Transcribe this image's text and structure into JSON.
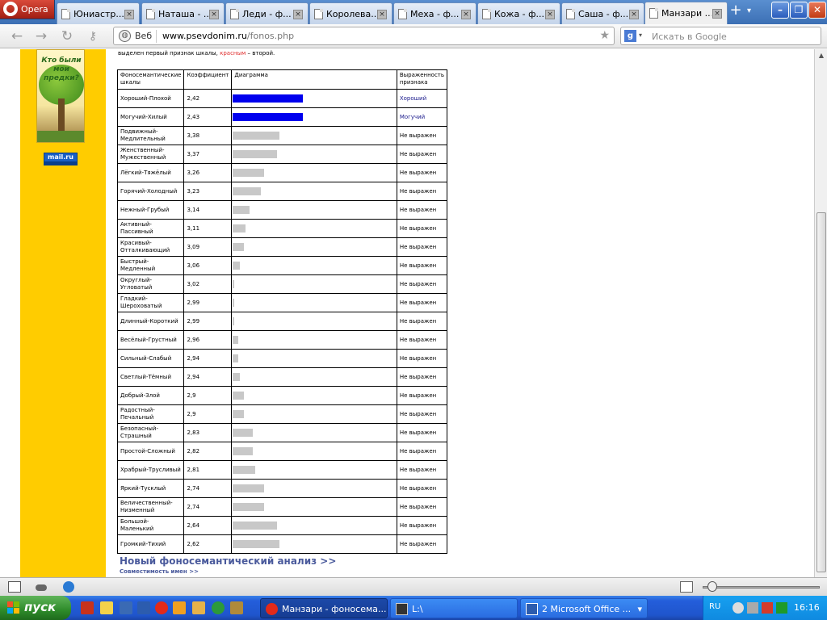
{
  "browser": {
    "menu_label": "Opera",
    "tabs": [
      {
        "title": "Юниастр..."
      },
      {
        "title": "Наташа - ..."
      },
      {
        "title": "Леди - ф..."
      },
      {
        "title": "Королева..."
      },
      {
        "title": "Меха - ф..."
      },
      {
        "title": "Кожа - ф..."
      },
      {
        "title": "Саша - ф..."
      },
      {
        "title": "Манзари ..."
      }
    ],
    "new_tab_symbol": "+",
    "address": {
      "site_label": "Веб",
      "host": "www.psevdonim.ru",
      "path": "/fonos.php"
    },
    "search": {
      "engine_badge": "g",
      "placeholder": "Искать в Google"
    }
  },
  "page": {
    "sidebar": {
      "banner_text": "Кто были мои предки?",
      "counter_text": "mail.ru"
    },
    "intro": {
      "before": "выделен первый признак шкалы, ",
      "red_word": "красным",
      "after": " – второй."
    },
    "table": {
      "headers": {
        "scale": "Фоносемантические шкалы",
        "coef": "Коэффициент",
        "diagram": "Диаграмма",
        "expr": "Выраженность признака"
      },
      "rows": [
        {
          "scale": "Хороший-Плохой",
          "coef": "2,42",
          "bar": 0.38,
          "blue": true,
          "expr": "Хороший",
          "link": true
        },
        {
          "scale": "Могучий-Хилый",
          "coef": "2,43",
          "bar": 0.38,
          "blue": true,
          "expr": "Могучий",
          "link": true
        },
        {
          "scale": "Подвижный-Медлительный",
          "coef": "3,38",
          "bar": 0.25,
          "blue": false,
          "expr": "Не выражен",
          "link": false
        },
        {
          "scale": "Женственный-Мужественный",
          "coef": "3,37",
          "bar": 0.24,
          "blue": false,
          "expr": "Не выражен",
          "link": false
        },
        {
          "scale": "Лёгкий-Тяжёлый",
          "coef": "3,26",
          "bar": 0.17,
          "blue": false,
          "expr": "Не выражен",
          "link": false
        },
        {
          "scale": "Горячий-Холодный",
          "coef": "3,23",
          "bar": 0.15,
          "blue": false,
          "expr": "Не выражен",
          "link": false
        },
        {
          "scale": "Нежный-Грубый",
          "coef": "3,14",
          "bar": 0.09,
          "blue": false,
          "expr": "Не выражен",
          "link": false
        },
        {
          "scale": "Активный-Пассивный",
          "coef": "3,11",
          "bar": 0.07,
          "blue": false,
          "expr": "Не выражен",
          "link": false
        },
        {
          "scale": "Красивый-Отталкивающий",
          "coef": "3,09",
          "bar": 0.06,
          "blue": false,
          "expr": "Не выражен",
          "link": false
        },
        {
          "scale": "Быстрый-Медленный",
          "coef": "3,06",
          "bar": 0.04,
          "blue": false,
          "expr": "Не выражен",
          "link": false
        },
        {
          "scale": "Округлый-Угловатый",
          "coef": "3,02",
          "bar": 0.01,
          "blue": false,
          "expr": "Не выражен",
          "link": false
        },
        {
          "scale": "Гладкий-Шероховатый",
          "coef": "2,99",
          "bar": 0.01,
          "blue": false,
          "expr": "Не выражен",
          "link": false
        },
        {
          "scale": "Длинный-Короткий",
          "coef": "2,99",
          "bar": 0.01,
          "blue": false,
          "expr": "Не выражен",
          "link": false
        },
        {
          "scale": "Весёлый-Грустный",
          "coef": "2,96",
          "bar": 0.03,
          "blue": false,
          "expr": "Не выражен",
          "link": false
        },
        {
          "scale": "Сильный-Слабый",
          "coef": "2,94",
          "bar": 0.03,
          "blue": false,
          "expr": "Не выражен",
          "link": false
        },
        {
          "scale": "Светлый-Тёмный",
          "coef": "2,94",
          "bar": 0.04,
          "blue": false,
          "expr": "Не выражен",
          "link": false
        },
        {
          "scale": "Добрый-Злой",
          "coef": "2,9",
          "bar": 0.06,
          "blue": false,
          "expr": "Не выражен",
          "link": false
        },
        {
          "scale": "Радостный-Печальный",
          "coef": "2,9",
          "bar": 0.06,
          "blue": false,
          "expr": "Не выражен",
          "link": false
        },
        {
          "scale": "Безопасный-Страшный",
          "coef": "2,83",
          "bar": 0.11,
          "blue": false,
          "expr": "Не выражен",
          "link": false
        },
        {
          "scale": "Простой-Сложный",
          "coef": "2,82",
          "bar": 0.11,
          "blue": false,
          "expr": "Не выражен",
          "link": false
        },
        {
          "scale": "Храбрый-Трусливый",
          "coef": "2,81",
          "bar": 0.12,
          "blue": false,
          "expr": "Не выражен",
          "link": false
        },
        {
          "scale": "Яркий-Тусклый",
          "coef": "2,74",
          "bar": 0.17,
          "blue": false,
          "expr": "Не выражен",
          "link": false
        },
        {
          "scale": "Величественный-Низменный",
          "coef": "2,74",
          "bar": 0.17,
          "blue": false,
          "expr": "Не выражен",
          "link": false
        },
        {
          "scale": "Большой-Маленький",
          "coef": "2,64",
          "bar": 0.24,
          "blue": false,
          "expr": "Не выражен",
          "link": false
        },
        {
          "scale": "Громкий-Тихий",
          "coef": "2,62",
          "bar": 0.25,
          "blue": false,
          "expr": "Не выражен",
          "link": false
        }
      ]
    },
    "new_analysis_link": "Новый фоносемантический анализ >>",
    "compat_link": "Совместимость имен >>"
  },
  "taskbar": {
    "start_label": "пуск",
    "tasks": [
      {
        "title": "Манзари - фоносема..."
      },
      {
        "title": "L:\\"
      },
      {
        "title": "2 Microsoft Office ..."
      }
    ],
    "lang": "RU",
    "clock": "16:16"
  },
  "colors": {
    "sidebar_yellow": "#ffcc00",
    "positive_bar": "#0000ee",
    "neutral_bar": "#c8c8c8",
    "link_color": "#4a5a9c"
  }
}
